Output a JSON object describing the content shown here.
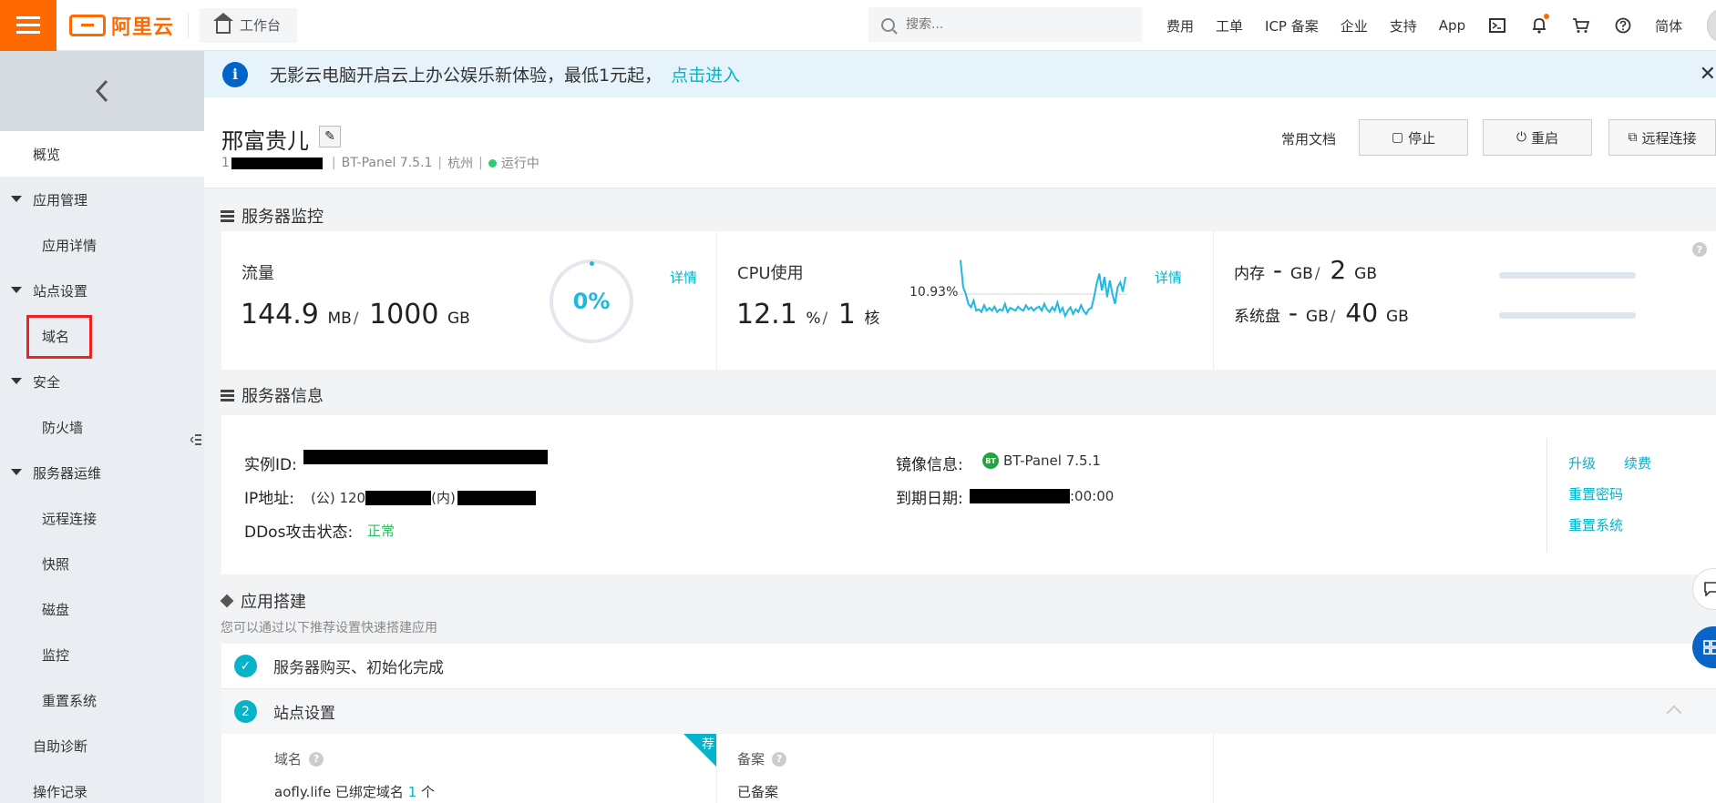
{
  "topbar": {
    "brand": "阿里云",
    "workbench": "工作台",
    "search_placeholder": "搜索...",
    "nav": [
      "费用",
      "工单",
      "ICP 备案",
      "企业",
      "支持",
      "App"
    ],
    "lang": "简体",
    "icons": [
      "terminal-icon",
      "bell-icon",
      "cart-icon",
      "help-icon"
    ]
  },
  "sidebar": {
    "overview": "概览",
    "groups": [
      {
        "label": "应用管理",
        "items": [
          "应用详情"
        ]
      },
      {
        "label": "站点设置",
        "items": [
          "域名"
        ]
      },
      {
        "label": "安全",
        "items": [
          "防火墙"
        ]
      },
      {
        "label": "服务器运维",
        "items": [
          "远程连接",
          "快照",
          "磁盘",
          "监控",
          "重置系统"
        ]
      }
    ],
    "bottom": [
      "自助诊断",
      "操作记录"
    ]
  },
  "notice": {
    "message": "无影云电脑开启云上办公娱乐新体验，最低1元起，",
    "link": "点击进入"
  },
  "header": {
    "instance_name": "邢富贵儿",
    "id_prefix": "1",
    "image": "BT-Panel 7.5.1",
    "region": "杭州",
    "status": "运行中",
    "doc_link": "常用文档",
    "buttons": {
      "stop": "停止",
      "restart": "重启",
      "remote": "远程连接"
    }
  },
  "monitor": {
    "title": "服务器监控",
    "traffic": {
      "label": "流量",
      "used": "144.9",
      "used_unit": "MB",
      "total": "1000",
      "total_unit": "GB",
      "percent_label": "0%",
      "detail": "详情"
    },
    "cpu": {
      "label": "CPU使用",
      "value": "12.1",
      "unit": "%",
      "cores": "1",
      "cores_unit": "核",
      "peak_label": "10.93%",
      "detail": "详情",
      "series": [
        0.95,
        0.55,
        0.45,
        0.3,
        0.25,
        0.35,
        0.2,
        0.22,
        0.18,
        0.28,
        0.2,
        0.24,
        0.2,
        0.26,
        0.18,
        0.22,
        0.2,
        0.3,
        0.18,
        0.24,
        0.22,
        0.2,
        0.26,
        0.22,
        0.2,
        0.28,
        0.22,
        0.25,
        0.2,
        0.24,
        0.26,
        0.2,
        0.3,
        0.22,
        0.18,
        0.25,
        0.2,
        0.32,
        0.18,
        0.24,
        0.12,
        0.2,
        0.25,
        0.15,
        0.22,
        0.18,
        0.28,
        0.2,
        0.15,
        0.22,
        0.24,
        0.4,
        0.6,
        0.75,
        0.5,
        0.7,
        0.4,
        0.65,
        0.45,
        0.3,
        0.55,
        0.62,
        0.48,
        0.7
      ]
    },
    "memory": {
      "label": "内存",
      "used": "-",
      "used_unit": "GB",
      "total": "2",
      "total_unit": "GB"
    },
    "disk": {
      "label": "系统盘",
      "used": "-",
      "used_unit": "GB",
      "total": "40",
      "total_unit": "GB"
    }
  },
  "server_info": {
    "title": "服务器信息",
    "instance_id_label": "实例ID:",
    "ip_label": "IP地址:",
    "ip_public_prefix": "(公) 120",
    "ip_private_prefix": "(内)",
    "ddos_label": "DDos攻击状态:",
    "ddos_value": "正常",
    "image_label": "镜像信息:",
    "image_badge": "BT",
    "image_value": "BT-Panel 7.5.1",
    "expire_label": "到期日期:",
    "expire_suffix": ":00:00",
    "actions": [
      "升级",
      "续费",
      "重置密码",
      "重置系统"
    ]
  },
  "app_build": {
    "title": "应用搭建",
    "subtitle": "您可以通过以下推荐设置快速搭建应用",
    "step1": {
      "index": "✓",
      "title": "服务器购买、初始化完成"
    },
    "step2": {
      "index": "2",
      "title": "站点设置"
    },
    "domain": {
      "label": "域名",
      "value_prefix": "aofly.life 已绑定域名",
      "count": "1",
      "value_suffix": "个",
      "tag": "荐"
    },
    "icp": {
      "label": "备案",
      "value": "已备案"
    }
  }
}
